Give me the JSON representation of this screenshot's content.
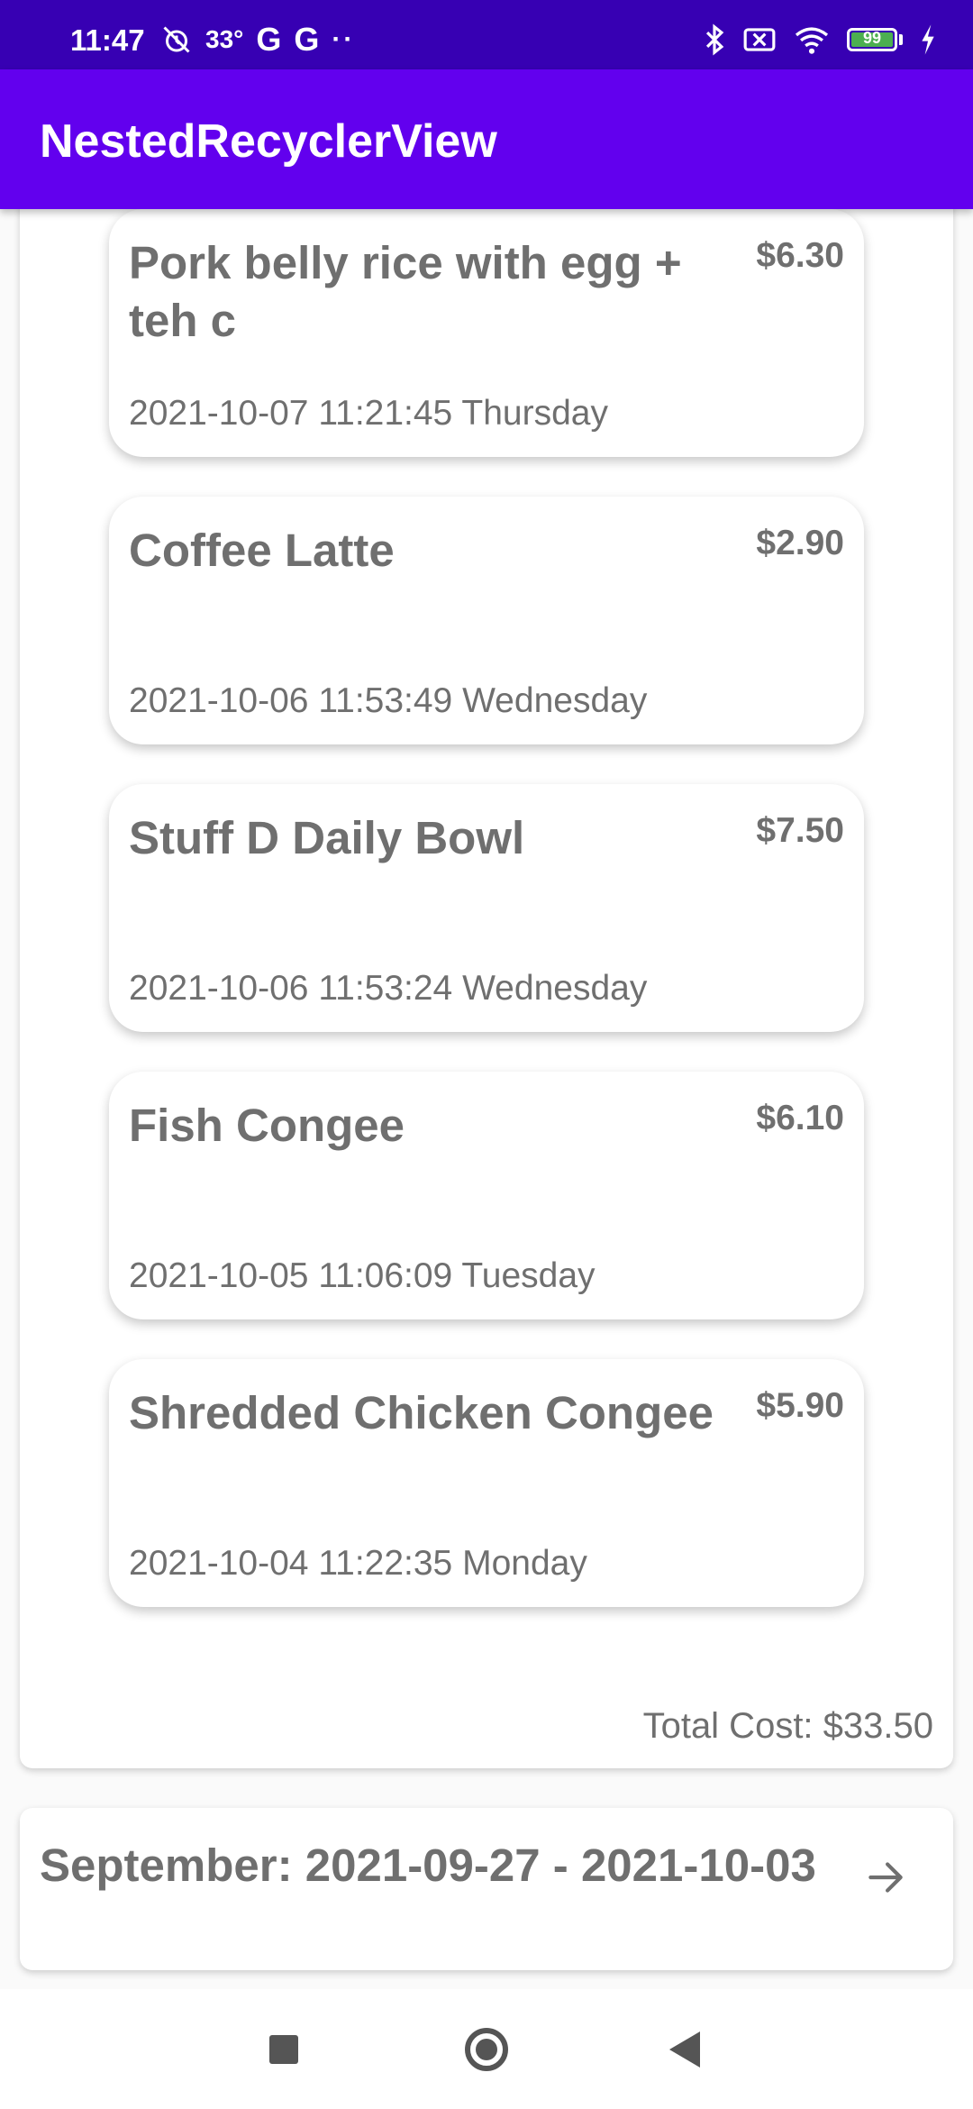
{
  "status_bar": {
    "time": "11:47",
    "temperature": "33°",
    "g_icon_1": "G",
    "g_icon_2": "G",
    "more_dots": "··",
    "battery_level": "99",
    "icons": [
      "alarm-off-icon",
      "google-icon",
      "bluetooth-icon",
      "sim-off-icon",
      "wifi-icon",
      "battery-icon",
      "charging-icon"
    ]
  },
  "app_bar": {
    "title": "NestedRecyclerView",
    "color": "#6200ee"
  },
  "current_week": {
    "expenses": [
      {
        "name": "Pork belly rice with egg + teh c",
        "price": "$6.30",
        "date": "2021-10-07 11:21:45 Thursday"
      },
      {
        "name": "Coffee Latte",
        "price": "$2.90",
        "date": "2021-10-06 11:53:49 Wednesday"
      },
      {
        "name": "Stuff D Daily Bowl",
        "price": "$7.50",
        "date": "2021-10-06 11:53:24 Wednesday"
      },
      {
        "name": "Fish Congee",
        "price": "$6.10",
        "date": "2021-10-05 11:06:09 Tuesday"
      },
      {
        "name": "Shredded Chicken Congee",
        "price": "$5.90",
        "date": "2021-10-04 11:22:35 Monday"
      }
    ],
    "total_cost": "Total Cost: $33.50"
  },
  "next_week": {
    "title": "September: 2021-09-27 - 2021-10-03",
    "icon": "arrow-right-icon"
  },
  "nav_bar": {
    "icons": [
      "recents-square-icon",
      "home-circle-icon",
      "back-triangle-icon"
    ]
  },
  "colors": {
    "status_bar": "#3700b3",
    "primary": "#6200ee",
    "text_gray": "#6f6f6f"
  }
}
